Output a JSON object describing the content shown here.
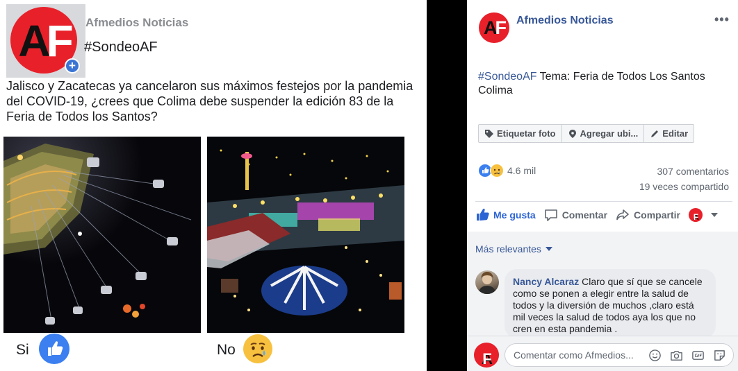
{
  "post_image": {
    "page_name": "Afmedios Noticias",
    "hashtag": "#SondeoAF",
    "question": "Jalisco y Zacatecas ya cancelaron sus máximos festejos por la pandemia del COVID-19, ¿crees que Colima debe suspender la edición 83 de la Feria de Todos los Santos?",
    "logo_text_a": "A",
    "logo_text_f": "F",
    "plus_badge": "+",
    "options": [
      {
        "label": "Si",
        "icon": "like-icon"
      },
      {
        "label": "No",
        "icon": "sad-face-icon"
      }
    ]
  },
  "sidebar": {
    "page_name": "Afmedios Noticias",
    "avatar_text_a": "A",
    "avatar_text_f": "F",
    "more_label": "•••",
    "post_hashtag": "#SondeoAF",
    "post_text": " Tema: Feria de Todos Los Santos Colima",
    "toolbar": {
      "tag_photo": "Etiquetar foto",
      "add_location": "Agregar ubi...",
      "edit": "Editar"
    },
    "reactions_count": "4.6 mil",
    "comments_count": "307 comentarios",
    "shares_count": "19 veces compartido",
    "actions": {
      "like": "Me gusta",
      "comment": "Comentar",
      "share": "Compartir"
    },
    "sort_label": "Más relevantes",
    "comment": {
      "author": "Nancy Alcaraz",
      "text": " Claro que sí que se cancele como se ponen a elegir entre la salud de todos y la diversión de muchos ,claro está mil veces la salud de todos aya los que no cren en esta pandemia ."
    },
    "composer_placeholder": "Comentar como Afmedios...",
    "colors": {
      "brand_red": "#e8202a",
      "facebook_blue": "#385898",
      "like_blue": "#2d64d4"
    }
  }
}
